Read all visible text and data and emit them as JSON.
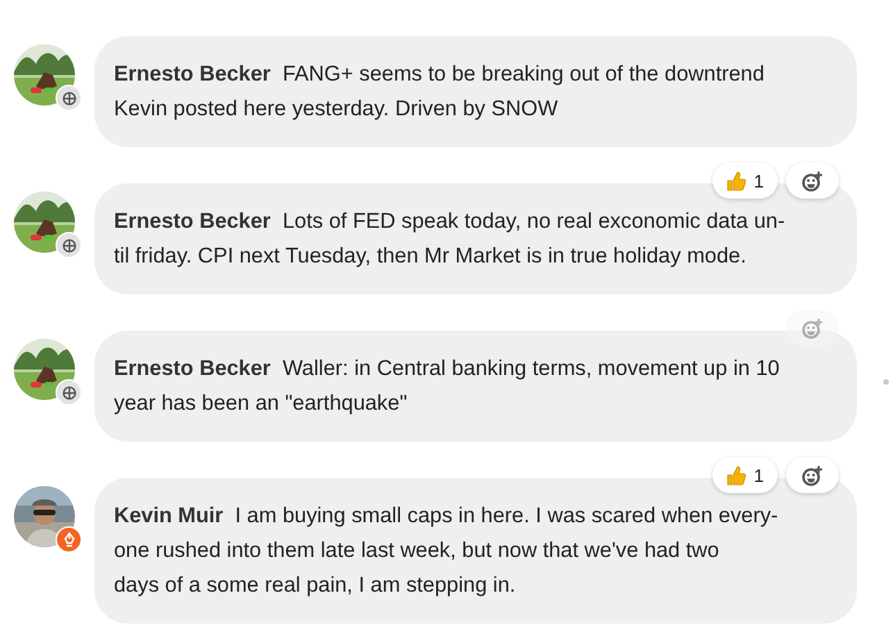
{
  "messages": [
    {
      "author": "Ernesto Becker",
      "text": "FANG+ seems to be breaking out of the downtrend\nKevin posted here yesterday. Driven by SNOW",
      "kind": "grid"
    },
    {
      "author": "Ernesto Becker",
      "text": "Lots of FED speak today, no real exconomic data un-\ntil friday. CPI next Tuesday, then Mr Market is in true holiday mode.",
      "kind": "grid",
      "reactions": [
        {
          "count": "1"
        }
      ],
      "add_reaction": {
        "dimmed": false
      }
    },
    {
      "author": "Ernesto Becker",
      "text": "Waller: in Central banking terms, movement up in 10\nyear has been an \"earthquake\"",
      "kind": "grid",
      "add_reaction": {
        "dimmed": true
      }
    },
    {
      "author": "Kevin Muir",
      "text": "I am buying small caps in here. I was scared when every-\none rushed into them late last week, but now that we've had two\ndays of a some real pain, I am stepping in.",
      "kind": "pen",
      "reactions": [
        {
          "count": "1"
        }
      ],
      "add_reaction": {
        "dimmed": false
      }
    }
  ]
}
